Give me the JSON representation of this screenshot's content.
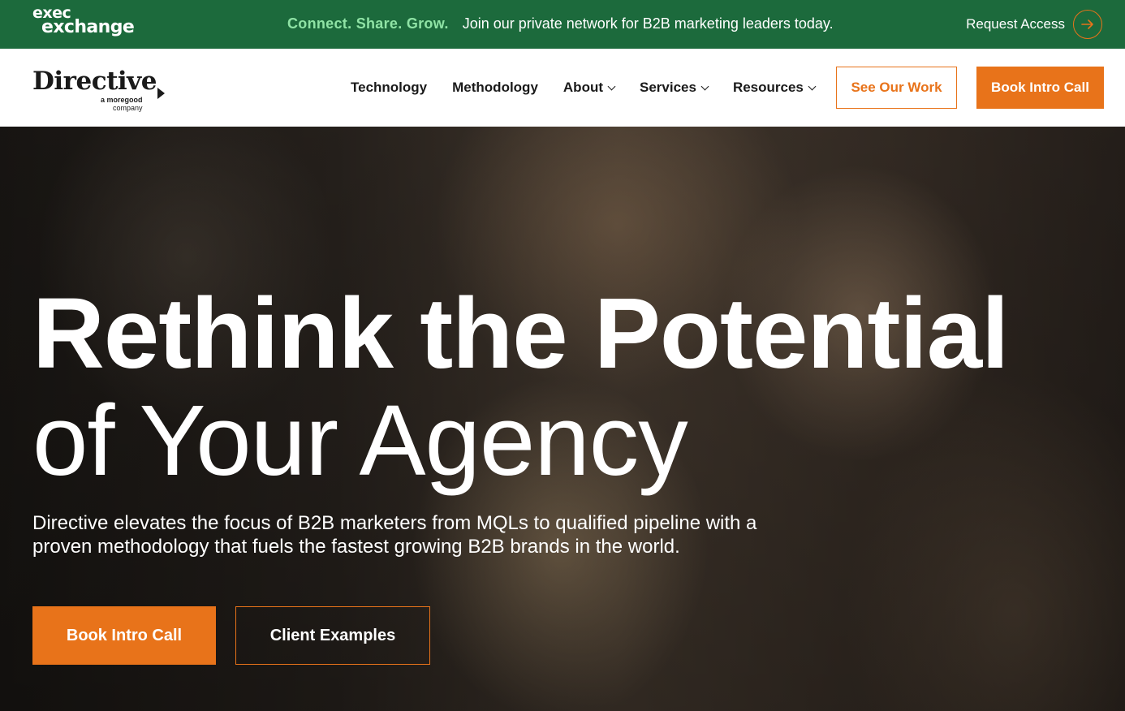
{
  "topbar": {
    "logo_line1": "exec",
    "logo_line2": "exchange",
    "tagline": "Connect. Share. Grow.",
    "message": "Join our private network for B2B marketing leaders today.",
    "request_label": "Request Access",
    "request_icon": "arrow-right-icon"
  },
  "nav": {
    "brand": "Directive",
    "brand_sub_1": "a moregood",
    "brand_sub_2": "company",
    "items": [
      {
        "label": "Technology",
        "dropdown": false
      },
      {
        "label": "Methodology",
        "dropdown": false
      },
      {
        "label": "About",
        "dropdown": true
      },
      {
        "label": "Services",
        "dropdown": true
      },
      {
        "label": "Resources",
        "dropdown": true
      }
    ],
    "see_work": "See Our Work",
    "book_call": "Book Intro Call"
  },
  "hero": {
    "headline_line1": "Rethink the Potential",
    "headline_line2": "of Your Agency",
    "description": "Directive elevates the focus of B2B marketers from MQLs to qualified pipeline with a proven methodology that fuels the fastest growing B2B brands in the world.",
    "primary_cta": "Book Intro Call",
    "secondary_cta": "Client Examples"
  },
  "colors": {
    "topbar_green": "#1c6a3c",
    "accent_orange": "#e8731a",
    "tagline_green": "#8fe3a5"
  }
}
